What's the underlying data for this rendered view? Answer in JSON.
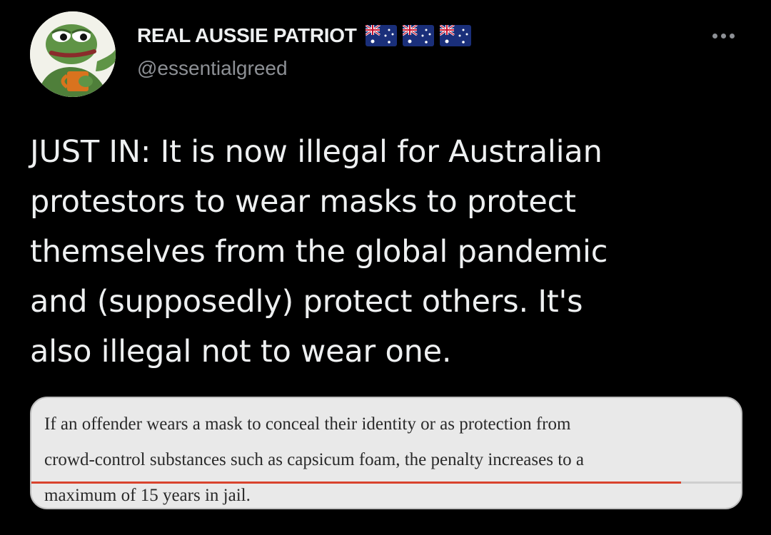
{
  "tweet": {
    "author": {
      "display_name": "REAL AUSSIE PATRIOT",
      "handle": "@essentialgreed",
      "avatar_icon": "pepe-frog-mug-avatar",
      "name_badges": [
        "australian-flag-icon",
        "australian-flag-icon",
        "australian-flag-icon"
      ]
    },
    "more_icon": "more-options-icon",
    "text_lines": [
      "JUST IN: It is now illegal for Australian",
      "protestors to wear masks to protect",
      "themselves from the global pandemic",
      "and (supposedly) protect others. It's",
      "also illegal not to wear one."
    ],
    "quote_image": {
      "lines": [
        "If an offender wears a mask to conceal their identity or as protection from",
        "crowd-control substances such as capsicum foam, the penalty increases to a",
        "maximum of 15 years in jail."
      ],
      "highlight_color": "#d9432d"
    }
  },
  "colors": {
    "background": "#000000",
    "text_primary": "#eef0f1",
    "text_secondary": "#8d9095"
  }
}
